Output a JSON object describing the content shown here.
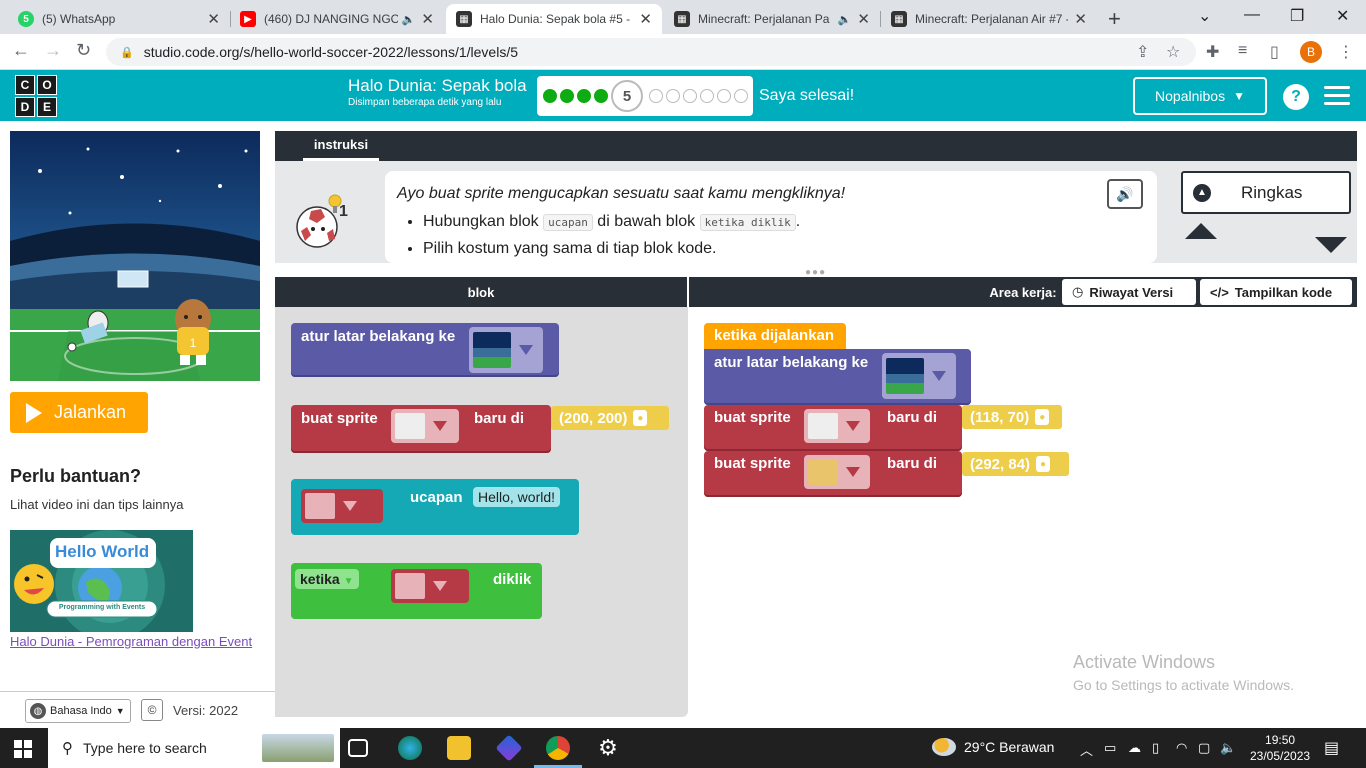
{
  "browser": {
    "tabs": [
      {
        "title": "(5) WhatsApp",
        "favicon": "whatsapp-icon",
        "color": "#25d366"
      },
      {
        "title": "(460) DJ NANGING NGO",
        "favicon": "youtube-icon",
        "color": "#ff0000"
      },
      {
        "title": "Halo Dunia: Sepak bola #5 -",
        "favicon": "codeorg-icon",
        "color": "#333333"
      },
      {
        "title": "Minecraft: Perjalanan Pa",
        "favicon": "codeorg-icon",
        "color": "#333333"
      },
      {
        "title": "Minecraft: Perjalanan Air #7 -",
        "favicon": "codeorg-icon",
        "color": "#333333"
      }
    ],
    "url": "studio.code.org/s/hello-world-soccer-2022/lessons/1/levels/5",
    "profile_initial": "B"
  },
  "header": {
    "logo": [
      "C",
      "O",
      "D",
      "E"
    ],
    "lesson_title": "Halo Dunia: Sepak bola",
    "saved_text": "Disimpan beberapa detik yang lalu",
    "current_level": "5",
    "levels_done": 4,
    "levels_todo": 6,
    "finish_label": "Saya selesai!",
    "user_name": "Nopalnibos",
    "help_label": "?"
  },
  "left": {
    "run_label": "Jalankan",
    "help_title": "Perlu bantuan?",
    "help_sub": "Lihat video ini dan tips lainnya",
    "video_title": "Hello World",
    "video_caption": "Programming with Events",
    "video_link": "Halo Dunia - Pemrograman dengan Event",
    "language": "Bahasa Indo",
    "copyright": "©",
    "version": "Versi: 2022"
  },
  "instructions": {
    "tab_label": "instruksi",
    "lead": "Ayo buat sprite mengucapkan sesuatu saat kamu mengkliknya!",
    "item1_pre": "Hubungkan blok",
    "item1_code1": "ucapan",
    "item1_mid": "di bawah blok",
    "item1_code2": "ketika diklik",
    "item1_post": ".",
    "item2": "Pilih kostum yang sama di tiap blok kode.",
    "avatar_badge": "1",
    "collapse_label": "Ringkas"
  },
  "workspace": {
    "toolbox_header": "blok",
    "area_header": "Area kerja:",
    "version_history": "Riwayat Versi",
    "show_code": "Tampilkan kode"
  },
  "toolbox_blocks": {
    "set_background": "atur latar belakang ke",
    "make_sprite": "buat sprite",
    "at_location": "baru di",
    "default_position": "(200, 200)",
    "say": "ucapan",
    "say_text": "Hello, world!",
    "when": "ketika",
    "clicked": "diklik"
  },
  "program": {
    "event": "ketika dijalankan",
    "set_background": "atur latar belakang ke",
    "sprite1_label": "buat sprite",
    "sprite1_at": "baru di",
    "sprite1_pos": "(118, 70)",
    "sprite2_label": "buat sprite",
    "sprite2_at": "baru di",
    "sprite2_pos": "(292, 84)"
  },
  "watermark": {
    "line1": "Activate Windows",
    "line2": "Go to Settings to activate Windows."
  },
  "taskbar": {
    "search_placeholder": "Type here to search",
    "weather": "29°C  Berawan",
    "time": "19:50",
    "date": "23/05/2023"
  },
  "colors": {
    "codeorg_teal": "#00adbc",
    "run_orange": "#ffa400",
    "sprite_red": "#b63946",
    "background_purple": "#5b5aa6",
    "event_green": "#3ec03e",
    "position_yellow": "#eecd4a"
  }
}
